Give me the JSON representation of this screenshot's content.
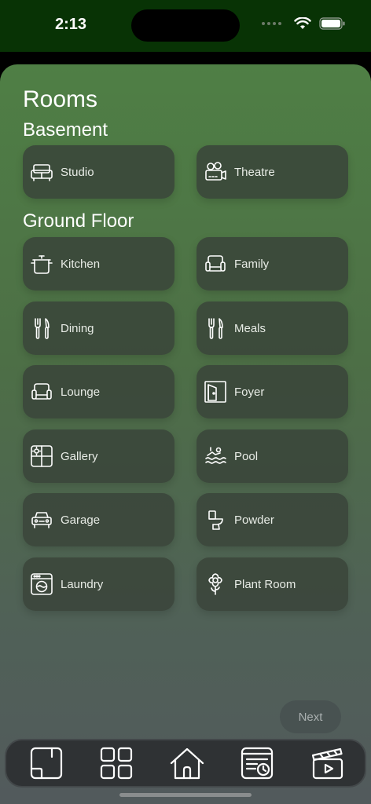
{
  "status": {
    "time": "2:13"
  },
  "page_title": "Rooms",
  "sections": {
    "basement": {
      "title": "Basement",
      "rooms": [
        {
          "label": "Studio",
          "icon": "sofa-icon"
        },
        {
          "label": "Theatre",
          "icon": "projector-icon"
        }
      ]
    },
    "ground_floor": {
      "title": "Ground Floor",
      "rooms": [
        {
          "label": "Kitchen",
          "icon": "pot-icon"
        },
        {
          "label": "Family",
          "icon": "armchair-icon"
        },
        {
          "label": "Dining",
          "icon": "cutlery-icon"
        },
        {
          "label": "Meals",
          "icon": "cutlery-icon"
        },
        {
          "label": "Lounge",
          "icon": "armchair-icon"
        },
        {
          "label": "Foyer",
          "icon": "door-icon"
        },
        {
          "label": "Gallery",
          "icon": "window-sun-icon"
        },
        {
          "label": "Pool",
          "icon": "swimmer-icon"
        },
        {
          "label": "Garage",
          "icon": "car-icon"
        },
        {
          "label": "Powder",
          "icon": "toilet-icon"
        },
        {
          "label": "Laundry",
          "icon": "washing-machine-icon"
        },
        {
          "label": "Plant Room",
          "icon": "flower-icon"
        }
      ]
    }
  },
  "next_button": "Next",
  "tabs": [
    {
      "name": "rooms-tab",
      "icon": "floorplan-icon"
    },
    {
      "name": "devices-tab",
      "icon": "grid-icon"
    },
    {
      "name": "home-tab",
      "icon": "home-icon"
    },
    {
      "name": "schedule-tab",
      "icon": "schedule-icon"
    },
    {
      "name": "scenes-tab",
      "icon": "clapper-icon"
    }
  ]
}
